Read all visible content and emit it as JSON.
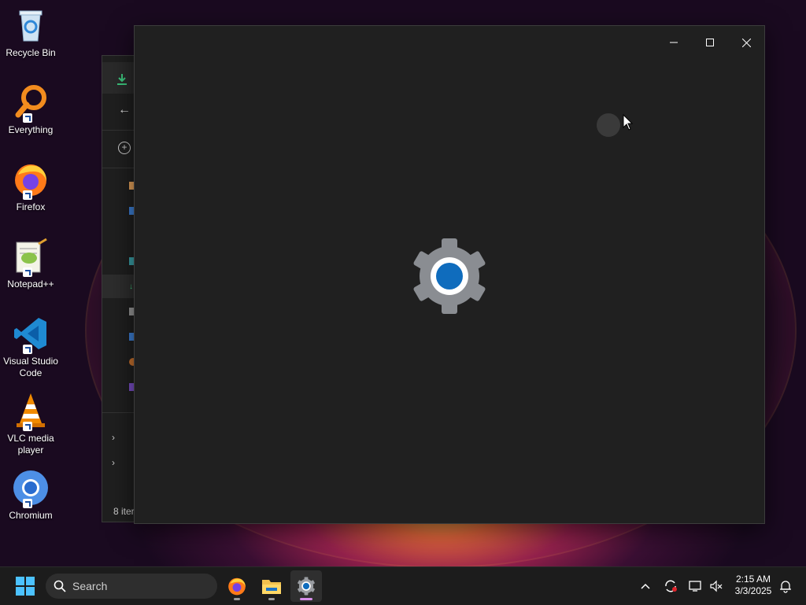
{
  "desktop": {
    "icons": [
      {
        "label": "Recycle Bin",
        "icon": "recycle-bin-icon"
      },
      {
        "label": "Everything",
        "icon": "everything-icon"
      },
      {
        "label": "Firefox",
        "icon": "firefox-icon"
      },
      {
        "label": "Notepad++",
        "icon": "notepad-plus-plus-icon"
      },
      {
        "label": "Visual Studio Code",
        "icon": "vscode-icon"
      },
      {
        "label": "VLC media player",
        "icon": "vlc-icon"
      },
      {
        "label": "Chromium",
        "icon": "chromium-icon"
      }
    ]
  },
  "explorer": {
    "status_text": "8 iter"
  },
  "settings_window": {
    "state": "loading",
    "splash_icon": "settings-gear-icon",
    "controls": [
      "minimize",
      "maximize",
      "close"
    ]
  },
  "taskbar": {
    "search_placeholder": "Search",
    "pinned": [
      "firefox-icon",
      "file-explorer-icon",
      "settings-icon"
    ],
    "active_app": "settings-icon",
    "time": "2:15 AM",
    "date": "3/3/2025"
  },
  "colors": {
    "accent": "#0f6cbd",
    "window_bg": "#202020",
    "taskbar_bg": "#1c1c1c",
    "active_indicator": "#d58de8"
  }
}
